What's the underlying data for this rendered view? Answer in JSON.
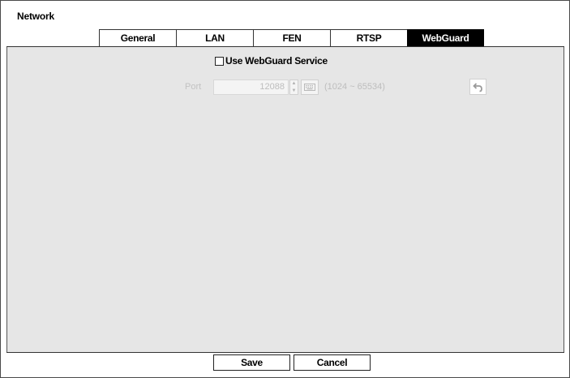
{
  "window": {
    "title": "Network"
  },
  "tabs": [
    {
      "label": "General",
      "active": false
    },
    {
      "label": "LAN",
      "active": false
    },
    {
      "label": "FEN",
      "active": false
    },
    {
      "label": "RTSP",
      "active": false
    },
    {
      "label": "WebGuard",
      "active": true
    }
  ],
  "webguard": {
    "use_service_label": "Use WebGuard Service",
    "use_service_checked": false,
    "port_label": "Port",
    "port_value": "12088",
    "port_range": "(1024 ~ 65534)"
  },
  "icons": {
    "stepper": "up-down-arrows-icon",
    "keyboard": "keyboard-icon",
    "undo": "undo-arrow-icon"
  },
  "footer": {
    "save_label": "Save",
    "cancel_label": "Cancel"
  },
  "colors": {
    "active_tab_bg": "#000000",
    "panel_bg": "#e6e6e6",
    "disabled_text": "#bdbdbd"
  }
}
